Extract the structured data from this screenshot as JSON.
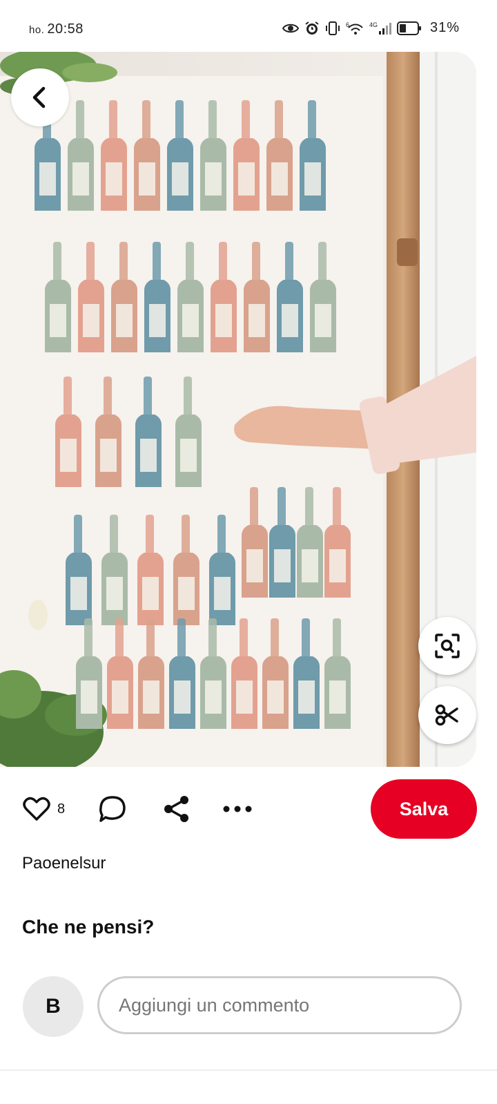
{
  "status_bar": {
    "time_prefix": "ho.",
    "time": "20:58",
    "battery": "31%",
    "network": "4G",
    "signal_sim": "6",
    "icons": [
      "eye-icon",
      "alarm-icon",
      "vibrate-icon",
      "wifi-icon",
      "signal-icon",
      "battery-icon"
    ]
  },
  "pin": {
    "image_alt": "Luggage tag escort card wall",
    "tag_colors": [
      "#6f9bab",
      "#a9bba8",
      "#e3a28f",
      "#d9a28c"
    ]
  },
  "actions": {
    "like_count": "8",
    "save_label": "Salva",
    "icons": [
      "heart-icon",
      "comment-icon",
      "share-icon",
      "more-icon"
    ]
  },
  "author": {
    "name": "Paoenelsur"
  },
  "comments": {
    "prompt": "Che ne pensi?",
    "avatar_initial": "B",
    "placeholder": "Aggiungi un commento"
  },
  "colors": {
    "save": "#e60023",
    "background": "#ffffff"
  }
}
